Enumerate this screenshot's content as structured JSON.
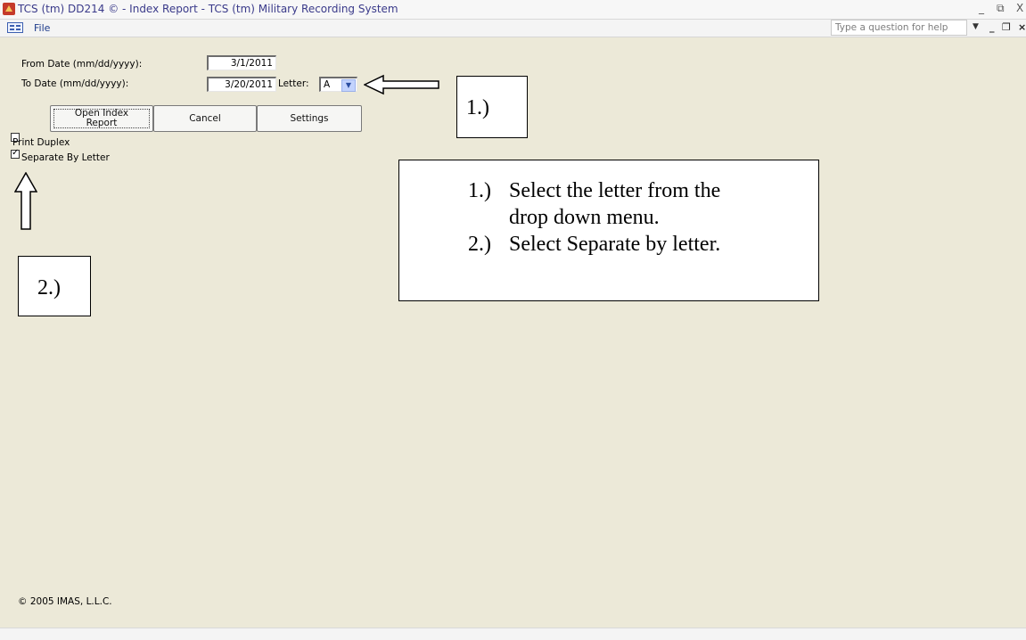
{
  "window": {
    "title": "TCS (tm) DD214 © - Index Report - TCS (tm) Military Recording System",
    "minimize": "_",
    "restore": "⧉",
    "close": "X"
  },
  "menubar": {
    "file_label": "File",
    "help_placeholder": "Type a question for help",
    "help_dropdown": "▼",
    "mdi_minimize": "_",
    "mdi_restore": "❐",
    "mdi_close": "×"
  },
  "form": {
    "from_label": "From Date (mm/dd/yyyy):",
    "from_value": "3/1/2011",
    "to_label": "To Date (mm/dd/yyyy):",
    "to_value": "3/20/2011",
    "letter_label": "Letter:",
    "letter_value": "A",
    "open_report_label_line1": "Open Index",
    "open_report_label_line2": "Report",
    "cancel_label": "Cancel",
    "settings_label": "Settings",
    "print_duplex_label": "Print Duplex",
    "print_duplex_checked": false,
    "separate_label": "Separate By Letter",
    "separate_checked": true
  },
  "annotations": {
    "callout_1": "1.)",
    "callout_2": "2.)",
    "instructions": [
      {
        "num": "1.)",
        "text_line1": "Select the letter from the",
        "text_line2": "drop down menu."
      },
      {
        "num": "2.)",
        "text_line1": "Select Separate by letter.",
        "text_line2": ""
      }
    ]
  },
  "footer": {
    "copyright": "© 2005 IMAS, L.L.C."
  }
}
